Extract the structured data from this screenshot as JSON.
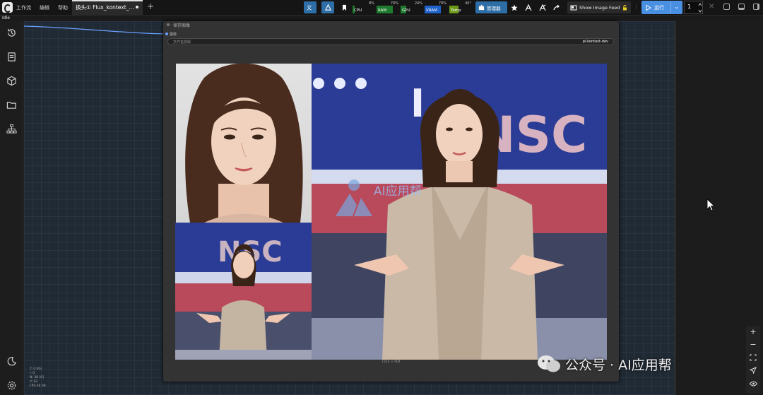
{
  "menu": {
    "workflow": "工作流",
    "edit": "编辑",
    "help": "帮助"
  },
  "tab": {
    "title": "换头① Flux_kontext_..."
  },
  "toolbar": {
    "monitors": [
      {
        "label": "CPU",
        "percent": "8%",
        "value": 0.08,
        "color": "#1e7a2e"
      },
      {
        "label": "RAM",
        "percent": "70%",
        "value": 0.7,
        "color": "#1e7a2e"
      },
      {
        "label": "GPU",
        "percent": "24%",
        "value": 0.24,
        "color": "#1e7a2e"
      },
      {
        "label": "VRAM",
        "percent": "70%",
        "value": 0.7,
        "color": "#1f62c9"
      },
      {
        "label": "Temp",
        "percent": "40°",
        "value": 0.4,
        "color": "#6b9a1a"
      }
    ],
    "manager_label": "管理器",
    "feed_label": "Show Image Feed",
    "run_label": "运行",
    "batch_count": "1"
  },
  "status": {
    "queue": "Idle"
  },
  "node": {
    "title": "保存图像",
    "image_input_label": "图像",
    "prefix_label": "文件名前缀",
    "prefix_value": "pl-kontext-dev",
    "image_size": "1320 × 904"
  },
  "stats": {
    "t": "T: 0.00s",
    "i": "I: 0",
    "n": "N: 38 [0]",
    "v": "V: 62",
    "fps": "FPS:48.08"
  },
  "watermark": {
    "text": "公众号 · AI应用帮",
    "overlay": "AI应用帮"
  },
  "colors": {
    "accent": "#4a90e2",
    "canvas_bg": "#202a34",
    "node_bg": "#333333"
  }
}
